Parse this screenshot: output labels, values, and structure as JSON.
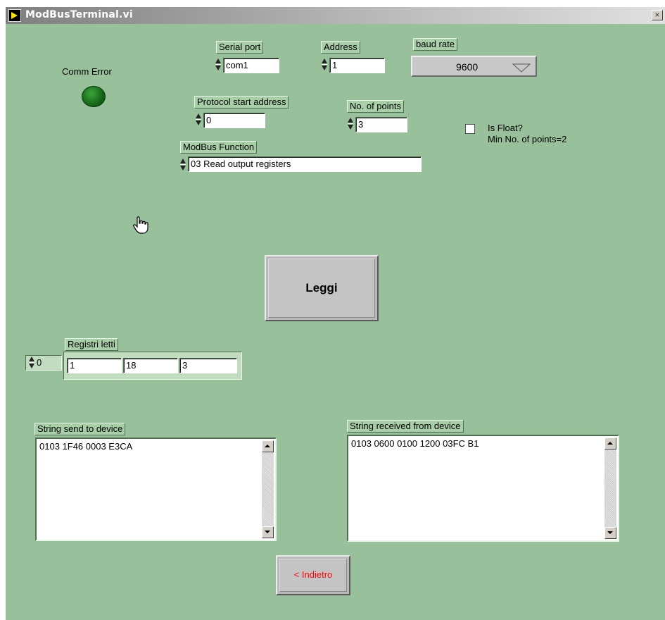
{
  "window": {
    "title": "ModBusTerminal.vi",
    "close_glyph": "×",
    "icon": "labview-vi-icon"
  },
  "indicator": {
    "label": "Comm Error"
  },
  "serial_port": {
    "label": "Serial port",
    "value": "com1"
  },
  "address": {
    "label": "Address",
    "value": "1"
  },
  "baud_rate": {
    "label": "baud rate",
    "value": "9600"
  },
  "protocol_start": {
    "label": "Protocol start address",
    "value": "0"
  },
  "num_points": {
    "label": "No. of points",
    "value": "3"
  },
  "is_float": {
    "label": "Is Float?",
    "note": "Min No. of points=2"
  },
  "modbus_function": {
    "label": "ModBus Function",
    "value": "03 Read output registers"
  },
  "read_button": {
    "label": "Leggi"
  },
  "registers": {
    "label": "Registri letti",
    "index": "0",
    "values": [
      "1",
      "18",
      "3"
    ]
  },
  "send_string": {
    "label": "String send to device",
    "value": "0103 1F46 0003 E3CA"
  },
  "recv_string": {
    "label": "String received from device",
    "value": "0103 0600 0100 1200 03FC B1"
  },
  "back_button": {
    "label": "< Indietro"
  },
  "colors": {
    "panel": "#98c09a",
    "led": "#1f7a1f",
    "back_label": "#ff0000"
  }
}
